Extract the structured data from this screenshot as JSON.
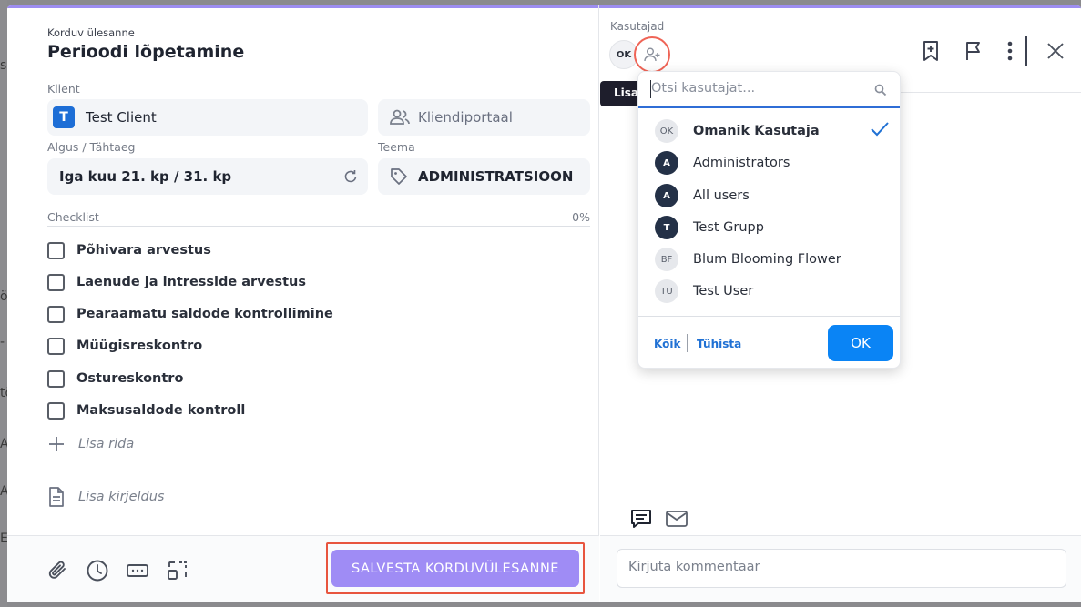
{
  "background": {
    "left_chars": [
      "sa",
      "ö",
      "-",
      "tö",
      "A",
      "A",
      "E"
    ],
    "bottom_right_text": "ok Omanik"
  },
  "task": {
    "subtitle": "Korduv ülesanne",
    "title": "Perioodi lõpetamine"
  },
  "client": {
    "label": "Klient",
    "badge": "T",
    "value": "Test Client",
    "portal_label": "Kliendiportaal"
  },
  "schedule": {
    "label": "Algus / Tähtaeg",
    "value": "Iga kuu 21. kp / 31. kp"
  },
  "topic": {
    "label": "Teema",
    "value": "ADMINISTRATSIOON"
  },
  "checklist": {
    "label": "Checklist",
    "percent": "0%",
    "items": [
      "Põhivara arvestus",
      "Laenude ja intresside arvestus",
      "Pearaamatu saldode kontrollimine",
      "Müügisreskontro",
      "Ostureskontro",
      "Maksusaldode kontroll"
    ],
    "add_row": "Lisa rida",
    "add_description": "Lisa kirjeldus"
  },
  "footer": {
    "save_label": "SALVESTA KORDUVÜLESANNE"
  },
  "users": {
    "label": "Kasutajad",
    "current_avatar": "OK",
    "tab_label": "Lisa"
  },
  "dropdown": {
    "search_placeholder": "Otsi kasutajat...",
    "items": [
      {
        "initials": "OK",
        "name": "Omanik Kasutaja",
        "selected": true,
        "style": "light"
      },
      {
        "initials": "A",
        "name": "Administrators",
        "selected": false,
        "style": "dark"
      },
      {
        "initials": "A",
        "name": "All users",
        "selected": false,
        "style": "dark"
      },
      {
        "initials": "T",
        "name": "Test Grupp",
        "selected": false,
        "style": "dark"
      },
      {
        "initials": "BF",
        "name": "Blum Blooming Flower",
        "selected": false,
        "style": "light"
      },
      {
        "initials": "TU",
        "name": "Test User",
        "selected": false,
        "style": "light"
      }
    ],
    "all_label": "Kõik",
    "cancel_label": "Tühista",
    "ok_label": "OK"
  },
  "comment": {
    "placeholder": "Kirjuta kommentaar"
  },
  "colors": {
    "accent_purple": "#9f8cf5",
    "highlight_red": "#e8553f",
    "primary_blue": "#0a84f5",
    "client_blue": "#1d6ed6"
  }
}
